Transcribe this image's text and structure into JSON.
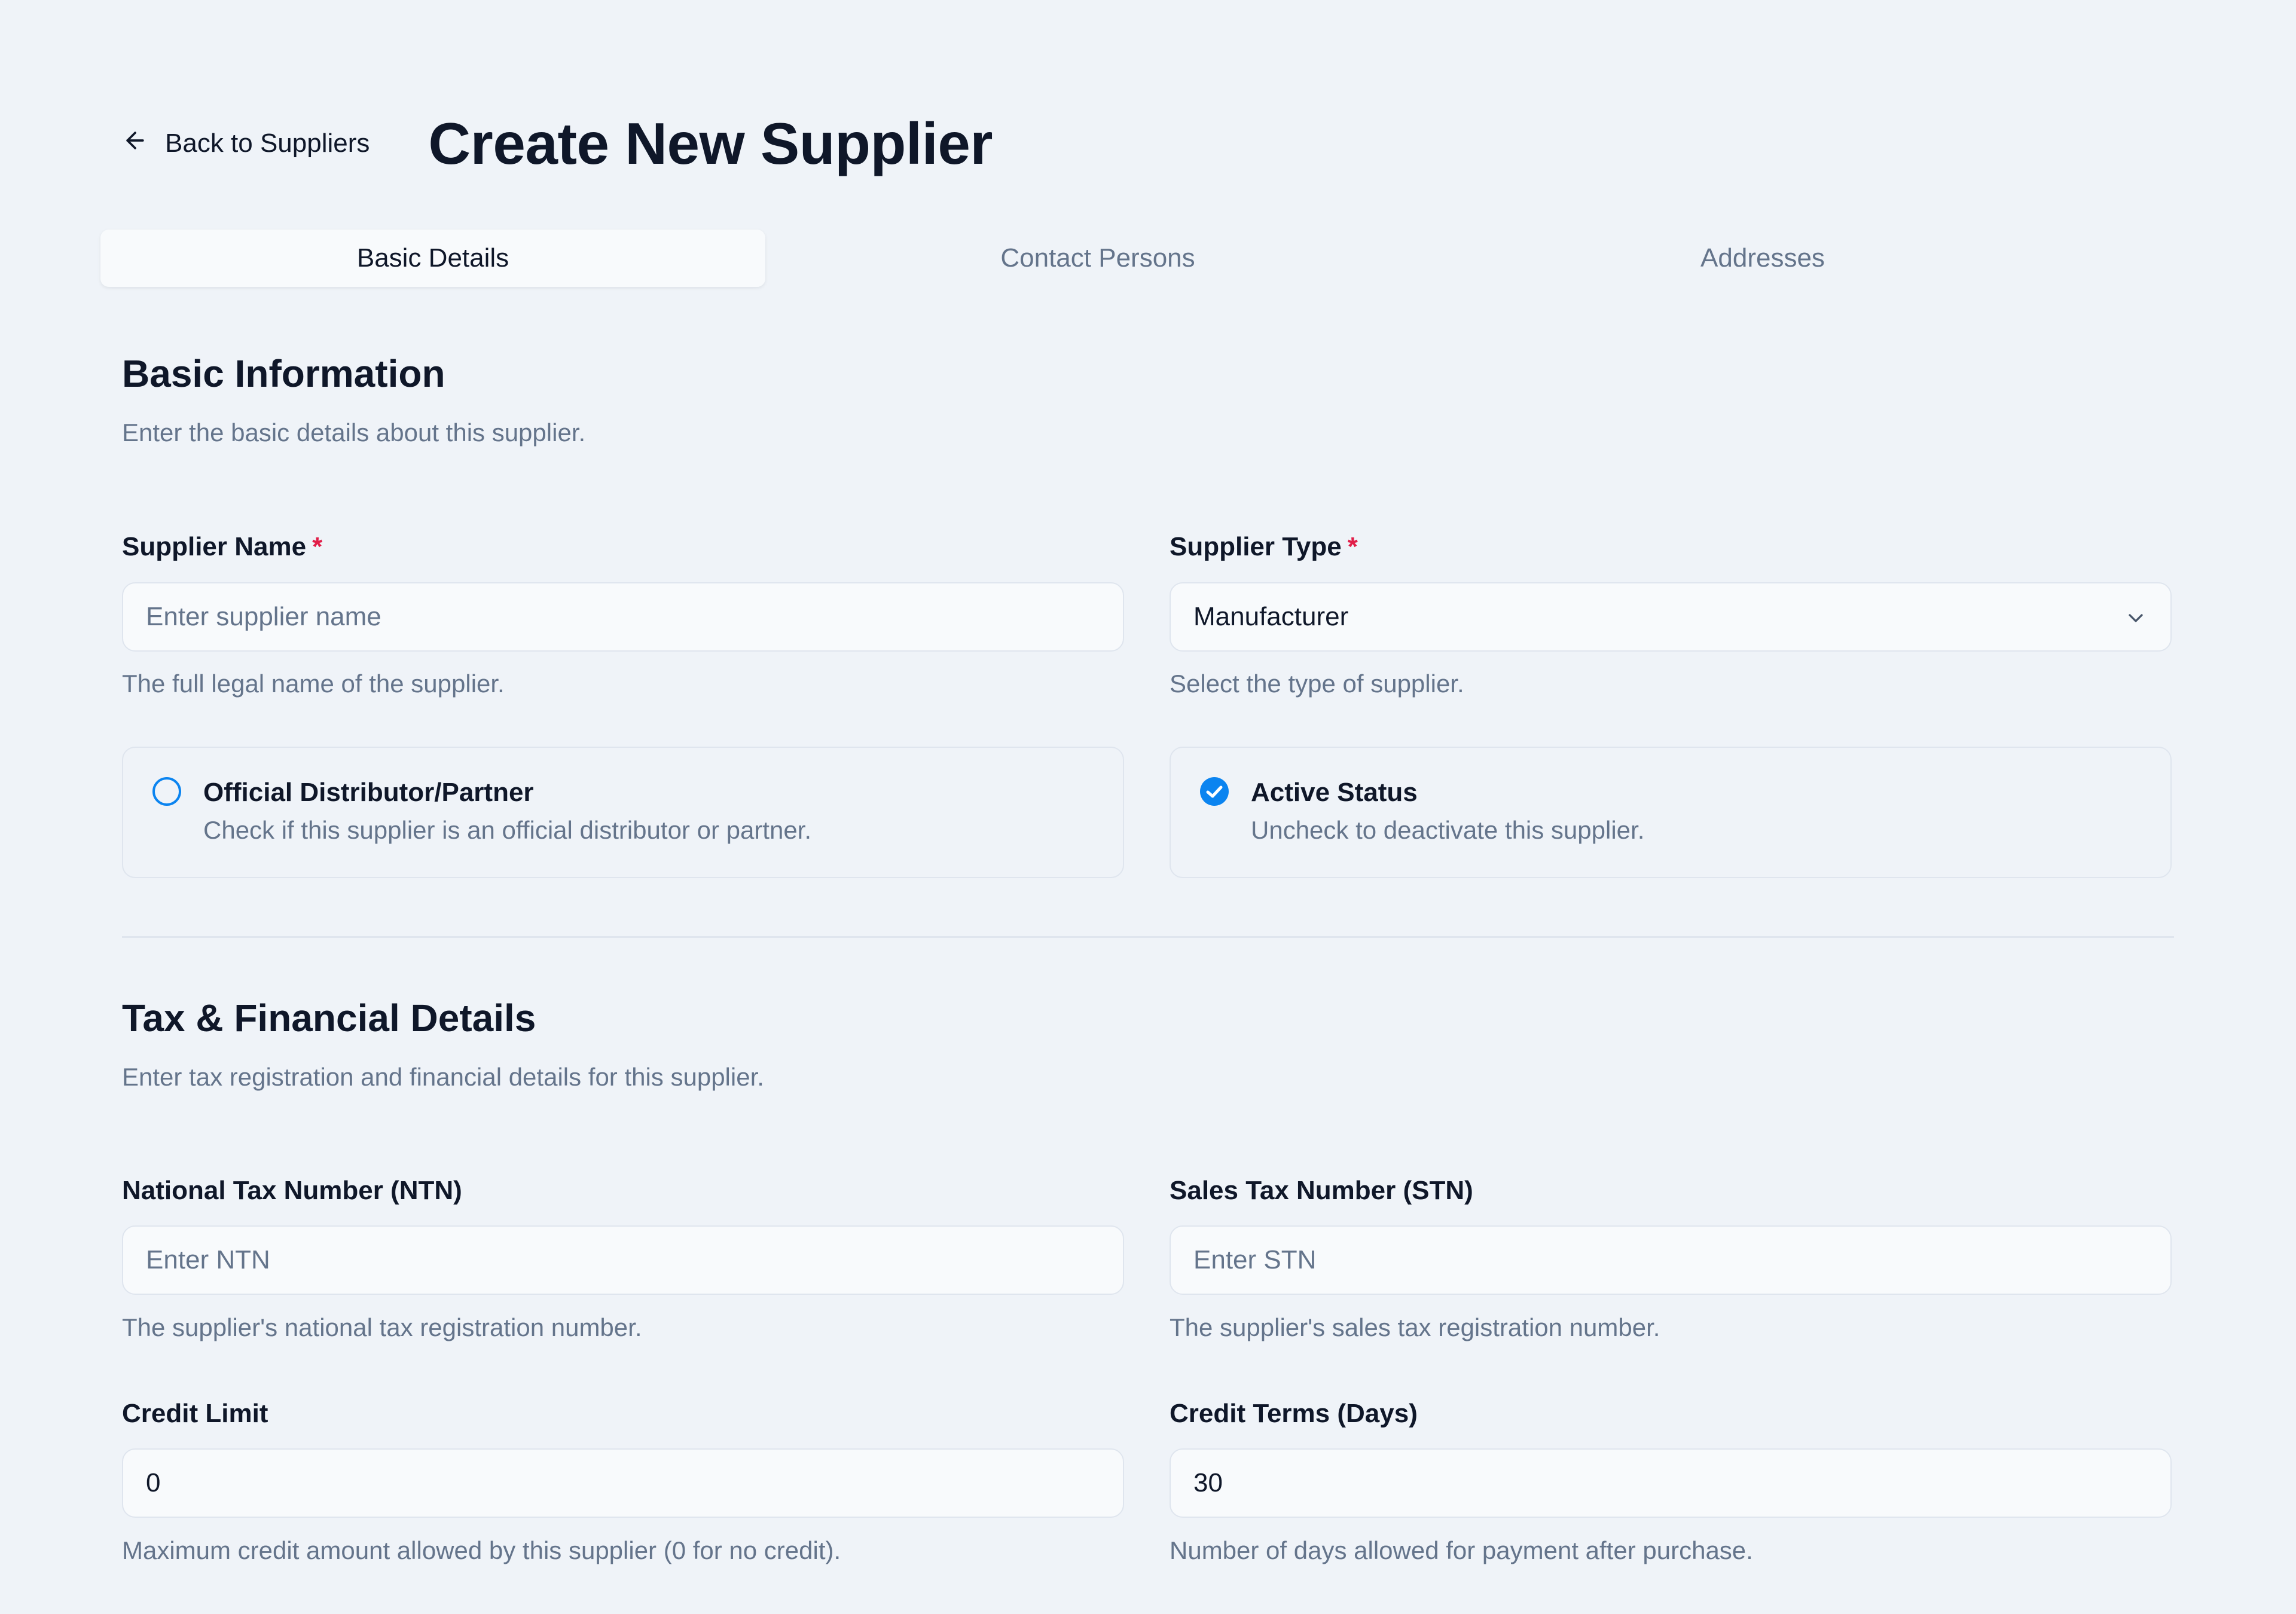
{
  "header": {
    "back_label": "Back to Suppliers",
    "title": "Create New Supplier"
  },
  "tabs": [
    {
      "label": "Basic Details",
      "active": true
    },
    {
      "label": "Contact Persons",
      "active": false
    },
    {
      "label": "Addresses",
      "active": false
    }
  ],
  "basic_info": {
    "title": "Basic Information",
    "description": "Enter the basic details about this supplier.",
    "supplier_name": {
      "label": "Supplier Name",
      "required_mark": "*",
      "value": "",
      "placeholder": "Enter supplier name",
      "help": "The full legal name of the supplier."
    },
    "supplier_type": {
      "label": "Supplier Type",
      "required_mark": "*",
      "selected": "Manufacturer",
      "help": "Select the type of supplier."
    },
    "official_distributor": {
      "title": "Official Distributor/Partner",
      "description": "Check if this supplier is an official distributor or partner.",
      "checked": false
    },
    "active_status": {
      "title": "Active Status",
      "description": "Uncheck to deactivate this supplier.",
      "checked": true
    }
  },
  "tax_financial": {
    "title": "Tax & Financial Details",
    "description": "Enter tax registration and financial details for this supplier.",
    "ntn": {
      "label": "National Tax Number (NTN)",
      "value": "",
      "placeholder": "Enter NTN",
      "help": "The supplier's national tax registration number."
    },
    "stn": {
      "label": "Sales Tax Number (STN)",
      "value": "",
      "placeholder": "Enter STN",
      "help": "The supplier's sales tax registration number."
    },
    "credit_limit": {
      "label": "Credit Limit",
      "value": "0",
      "help": "Maximum credit amount allowed by this supplier (0 for no credit)."
    },
    "credit_terms": {
      "label": "Credit Terms (Days)",
      "value": "30",
      "help": "Number of days allowed for payment after purchase."
    }
  },
  "colors": {
    "accent": "#0b84f0",
    "required": "#e11d48",
    "page_bg": "#eff3f8",
    "muted_text": "#64748b"
  },
  "icons": {
    "back": "arrow-left-icon",
    "select": "chevron-down-icon",
    "unchecked": "radio-unchecked-icon",
    "checked": "check-circle-icon"
  }
}
